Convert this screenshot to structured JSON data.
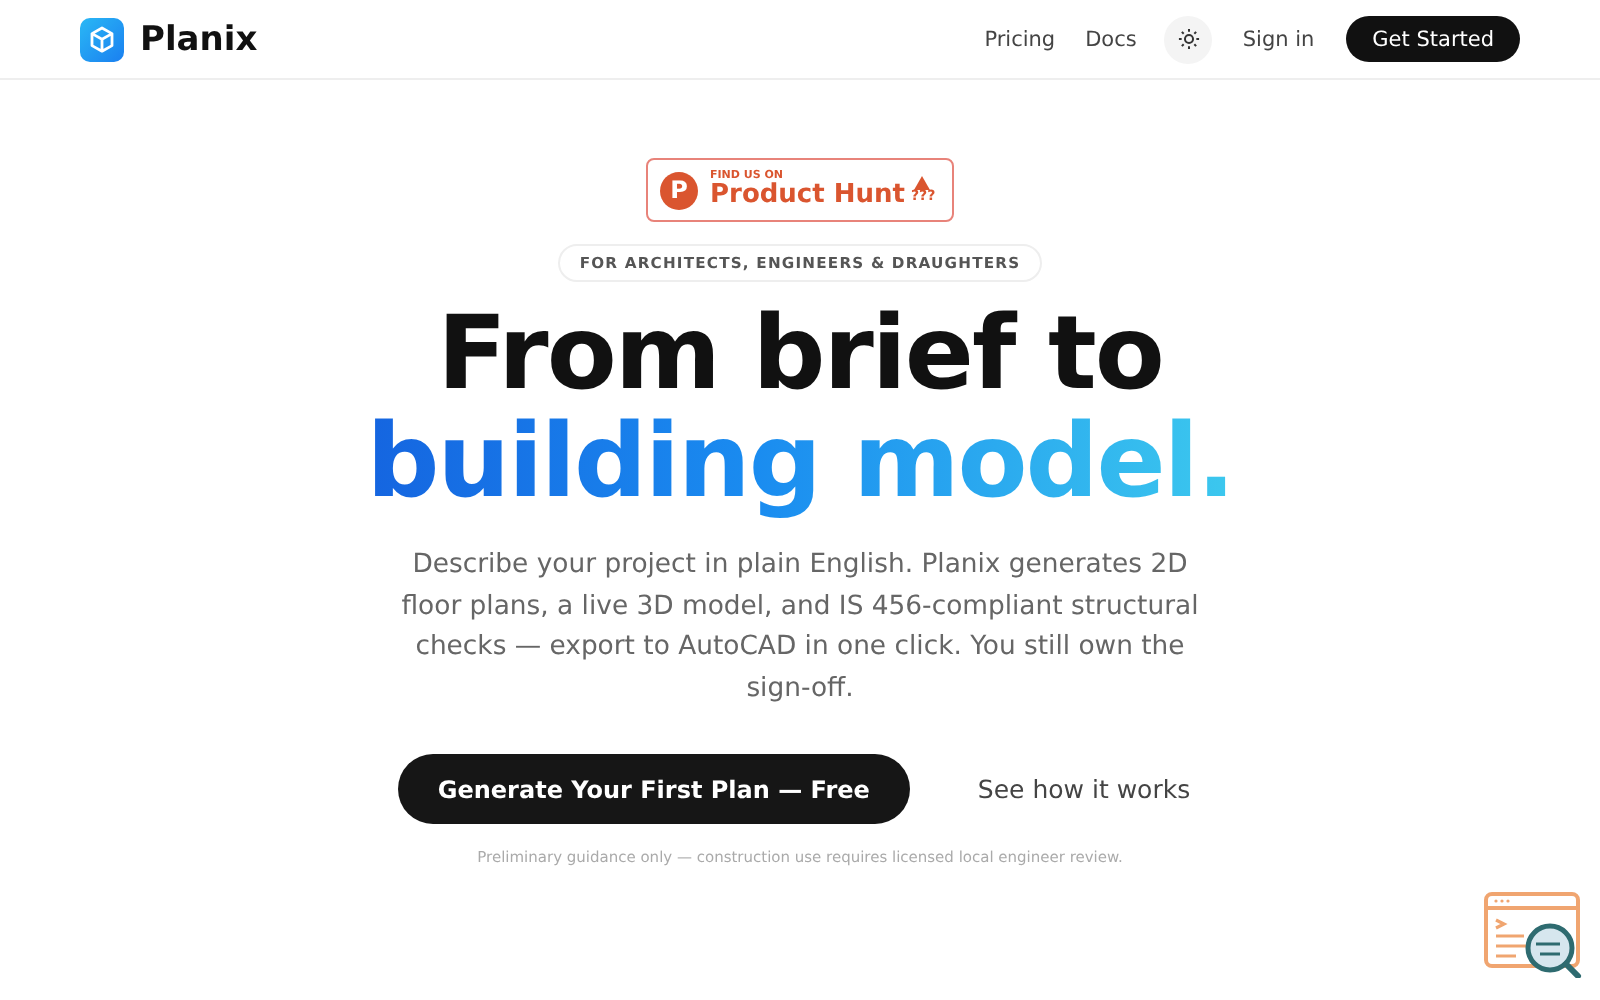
{
  "header": {
    "brand": "Planix",
    "nav": [
      "Pricing",
      "Docs"
    ],
    "sign_in": "Sign in",
    "cta": "Get Started"
  },
  "badge": {
    "logo_letter": "P",
    "kicker": "FIND US ON",
    "name": "Product Hunt",
    "count": "???"
  },
  "eyebrow": "FOR ARCHITECTS, ENGINEERS & DRAUGHTERS",
  "headline": {
    "line_1": "From brief to",
    "line_2": "building model."
  },
  "lede": "Describe your project in plain English. Planix generates 2D floor plans, a live 3D model, and IS 456-compliant structural checks — export to AutoCAD in one click. You still own the sign-off.",
  "primary_button": "Generate Your First Plan — Free",
  "secondary_button": "See how it works",
  "disclaimer": "Preliminary guidance only — construction use requires licensed local engineer review."
}
